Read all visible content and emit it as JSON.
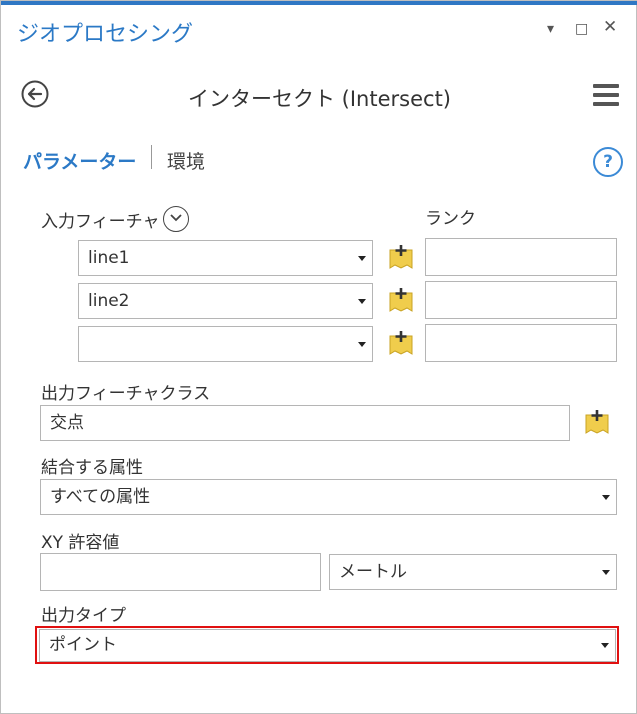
{
  "pane": {
    "title": "ジオプロセシング"
  },
  "window_controls": {
    "dropdown": "▾",
    "maximize": "□",
    "close": "✕"
  },
  "tool": {
    "title": "インターセクト (Intersect)"
  },
  "tabs": {
    "parameters": "パラメーター",
    "environments": "環境"
  },
  "help": {
    "label": "?"
  },
  "input_features": {
    "label": "入力フィーチャ",
    "rank_label": "ランク",
    "rows": [
      {
        "value": "line1",
        "rank": ""
      },
      {
        "value": "line2",
        "rank": ""
      },
      {
        "value": "",
        "rank": ""
      }
    ]
  },
  "output_feature_class": {
    "label": "出力フィーチャクラス",
    "value": "交点"
  },
  "join_attributes": {
    "label": "結合する属性",
    "value": "すべての属性"
  },
  "xy_tolerance": {
    "label": "XY 許容値",
    "value": "",
    "unit": "メートル"
  },
  "output_type": {
    "label": "出力タイプ",
    "value": "ポイント"
  },
  "colors": {
    "accent": "#2b79c6",
    "highlight": "#e01010",
    "add_icon": "#f0cd4c"
  }
}
